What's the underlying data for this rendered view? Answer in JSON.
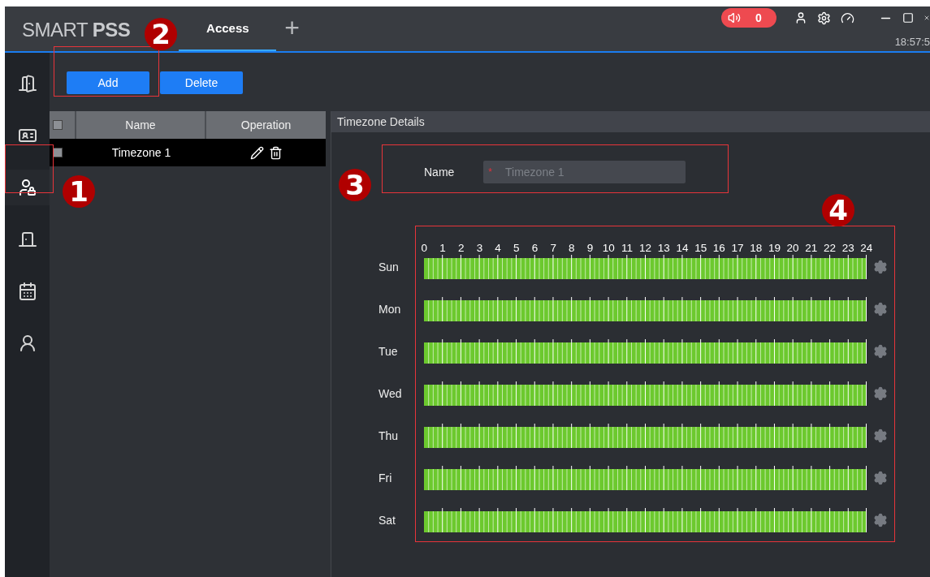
{
  "logo": {
    "light": "SMART",
    "bold": "PSS"
  },
  "tabs": [
    {
      "label": "Access",
      "selected": true
    }
  ],
  "new_tab": "+",
  "alarm": {
    "count": "0"
  },
  "clock": "18:57:5",
  "sidebar": {
    "items": [
      {
        "kind": "door",
        "selected": false
      },
      {
        "kind": "card",
        "selected": false
      },
      {
        "kind": "user-lock",
        "selected": true
      },
      {
        "kind": "door-closed",
        "selected": false
      },
      {
        "kind": "calendar",
        "selected": false
      },
      {
        "kind": "user",
        "selected": false
      }
    ]
  },
  "toolbar": {
    "buttons": [
      "Add",
      "Delete"
    ]
  },
  "table": {
    "header_checked": false,
    "columns": [
      "Name",
      "Operation"
    ],
    "rows": [
      {
        "name": "Timezone 1",
        "checked": false
      }
    ]
  },
  "details": {
    "title": "Timezone Details",
    "field": {
      "label": "Name",
      "required_mark": "*",
      "value": "Timezone 1"
    },
    "hours": [
      "0",
      "1",
      "2",
      "3",
      "4",
      "5",
      "6",
      "7",
      "8",
      "9",
      "10",
      "11",
      "12",
      "13",
      "14",
      "15",
      "16",
      "17",
      "18",
      "19",
      "20",
      "21",
      "22",
      "23",
      "24"
    ],
    "days": [
      "Sun",
      "Mon",
      "Tue",
      "Wed",
      "Thu",
      "Fri",
      "Sat"
    ]
  },
  "annotations": [
    {
      "label": "1"
    },
    {
      "label": "2"
    },
    {
      "label": "3"
    },
    {
      "label": "4"
    }
  ]
}
